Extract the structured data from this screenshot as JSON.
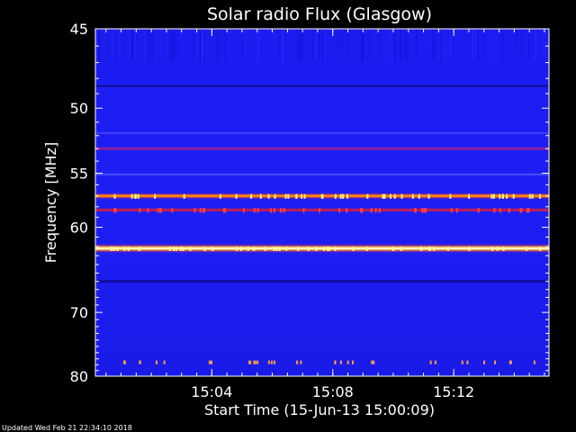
{
  "chart_data": {
    "type": "heatmap",
    "title": "Solar radio Flux (Glasgow)",
    "xlabel": "Start Time (15-Jun-13 15:00:09)",
    "ylabel": "Frequency [MHz]",
    "y_scale": "reciprocal",
    "ylim": [
      45,
      80
    ],
    "xlim": [
      "15:00:09",
      "15:15:09"
    ],
    "y_ticks": [
      45,
      50,
      55,
      60,
      70,
      80
    ],
    "x_ticks": [
      "15:04",
      "15:08",
      "15:12"
    ],
    "colormap": "blue-red-yellow",
    "colors": {
      "background": "#000000",
      "base": "#1a1aff",
      "mid": "#d01040",
      "hot": "#ffff80"
    },
    "persistent_bands_mhz": [
      48.5,
      51.8,
      53.0,
      55.1,
      57.0,
      58.3,
      62.2,
      66.0
    ],
    "bursts": [
      {
        "frequency_mhz": 57.0,
        "intensity": "high"
      },
      {
        "frequency_mhz": 62.2,
        "intensity": "high"
      },
      {
        "frequency_mhz": 58.3,
        "intensity": "medium"
      },
      {
        "frequency_mhz": 77.6,
        "intensity": "low"
      }
    ]
  },
  "footer": {
    "updated": "Updated Wed Feb 21 22:34:10 2018"
  }
}
